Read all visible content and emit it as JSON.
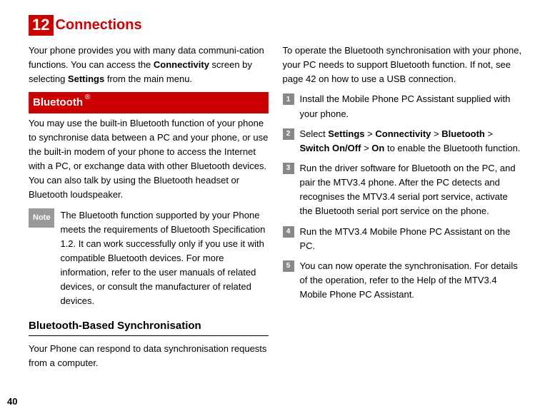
{
  "chapter": {
    "number": "12",
    "title": "Connections"
  },
  "col1": {
    "intro_before": "Your phone provides you with many data communi-cation functions. You can access the ",
    "intro_b1": "Connectivity",
    "intro_mid": " screen by selecting ",
    "intro_b2": "Settings",
    "intro_after": " from the main menu.",
    "section_title": "Bluetooth",
    "section_sup": "®",
    "section_body": "You may use the built-in Bluetooth function of your phone to synchronise data between a PC and your phone, or use the built-in modem of your phone to access the Internet with a PC, or exchange data with other Bluetooth devices. You can also talk by using the Bluetooth headset or Bluetooth loudspeaker.",
    "note_label": "Note",
    "note_body": "The Bluetooth function supported by your Phone meets the requirements of Bluetooth Specification 1.2. It can work successfully only if you use it with compatible Bluetooth devices. For more information, refer to the user manuals of related devices, or consult the manufacturer of related devices.",
    "subhead": "Bluetooth-Based Synchronisation",
    "subtext": "Your Phone can respond to data synchronisation requests from a computer."
  },
  "col2": {
    "intro": "To operate the Bluetooth synchronisation with your phone, your PC needs to support Bluetooth function. If not, see page 42 on how to use a USB connection.",
    "steps": [
      {
        "n": "1",
        "text": "Install the Mobile Phone PC Assistant supplied with your phone."
      },
      {
        "n": "2",
        "segments": [
          {
            "t": "Select ",
            "b": false
          },
          {
            "t": "Settings",
            "b": true
          },
          {
            "t": " > ",
            "b": false
          },
          {
            "t": "Connectivity",
            "b": true
          },
          {
            "t": " > ",
            "b": false
          },
          {
            "t": "Bluetooth",
            "b": true
          },
          {
            "t": " > ",
            "b": false
          },
          {
            "t": "Switch On/Off",
            "b": true
          },
          {
            "t": " > ",
            "b": false
          },
          {
            "t": "On",
            "b": true
          },
          {
            "t": " to enable the Bluetooth function.",
            "b": false
          }
        ]
      },
      {
        "n": "3",
        "text": "Run the driver software for Bluetooth on the PC, and pair the MTV3.4 phone. After the PC detects and recognises the MTV3.4 serial port service, activate the Bluetooth serial port service on the phone."
      },
      {
        "n": "4",
        "text": "Run the MTV3.4 Mobile Phone PC Assistant on the PC."
      },
      {
        "n": "5",
        "text": "You can now operate the synchronisation. For details of the operation, refer to the Help of the MTV3.4 Mobile Phone PC Assistant."
      }
    ]
  },
  "page_number": "40"
}
